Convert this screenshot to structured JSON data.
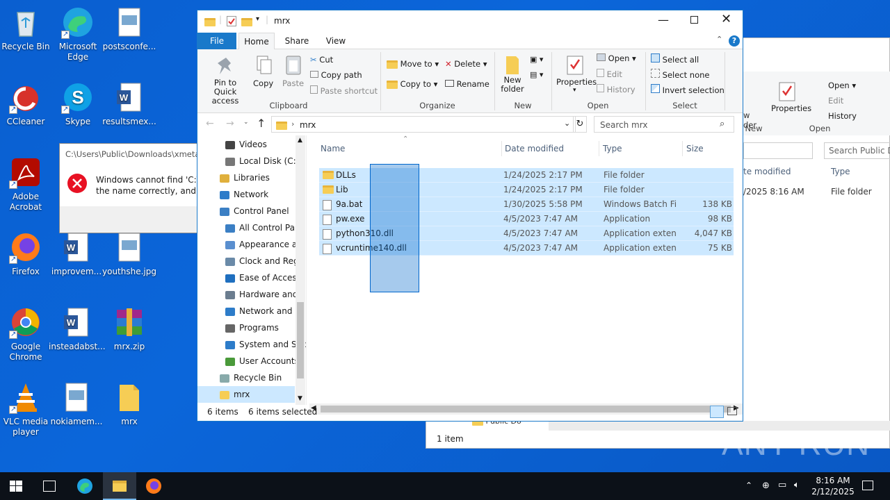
{
  "desktop": {
    "icons": [
      {
        "label": "Recycle Bin",
        "icon": "recycle-bin-icon"
      },
      {
        "label": "Microsoft Edge",
        "icon": "edge-icon"
      },
      {
        "label": "postsconfe...",
        "icon": "image-file-icon"
      },
      {
        "label": "CCleaner",
        "icon": "ccleaner-icon"
      },
      {
        "label": "Skype",
        "icon": "skype-icon"
      },
      {
        "label": "resultsmex...",
        "icon": "word-doc-icon"
      },
      {
        "label": "Adobe Acrobat",
        "icon": "acrobat-icon"
      },
      {
        "label": "c...",
        "icon": "file-icon"
      },
      {
        "label": "Firefox",
        "icon": "firefox-icon"
      },
      {
        "label": "improvem...",
        "icon": "word-doc-icon"
      },
      {
        "label": "youthshe.jpg",
        "icon": "image-file-icon"
      },
      {
        "label": "Google Chrome",
        "icon": "chrome-icon"
      },
      {
        "label": "insteadabst...",
        "icon": "word-doc-icon"
      },
      {
        "label": "mrx.zip",
        "icon": "winrar-icon"
      },
      {
        "label": "VLC media player",
        "icon": "vlc-icon"
      },
      {
        "label": "nokiamem...",
        "icon": "image-file-icon"
      },
      {
        "label": "mrx",
        "icon": "folder-icon"
      }
    ]
  },
  "error_dialog": {
    "path": "C:\\Users\\Public\\Downloads\\xmetav",
    "message_line1": "Windows cannot find 'C:\\Us",
    "message_line2": "the name correctly, and the"
  },
  "bg_explorer": {
    "ribbon": {
      "open": "Open",
      "edit": "Edit",
      "history": "History",
      "properties": "Properties",
      "open_group": "Open",
      "new_group": "New",
      "new_folder_partial": "w\nder"
    },
    "search_placeholder": "Search Public Do",
    "col_date": "te modified",
    "col_type": "Type",
    "row_date": "/2025 8:16 AM",
    "row_type": "File folder",
    "nav_partial": "Public Do",
    "status": "1 item"
  },
  "explorer": {
    "title": "mrx",
    "tabs": [
      "File",
      "Home",
      "Share",
      "View"
    ],
    "ribbon": {
      "pin": "Pin to Quick access",
      "copy": "Copy",
      "paste": "Paste",
      "cut": "Cut",
      "copy_path": "Copy path",
      "paste_shortcut": "Paste shortcut",
      "clipboard": "Clipboard",
      "move_to": "Move to",
      "copy_to": "Copy to",
      "delete": "Delete",
      "rename": "Rename",
      "organize": "Organize",
      "new_folder_1": "New",
      "new_folder_2": "folder",
      "new_group": "New",
      "properties": "Properties",
      "open": "Open",
      "edit": "Edit",
      "history": "History",
      "open_group": "Open",
      "select_all": "Select all",
      "select_none": "Select none",
      "invert_selection": "Invert selection",
      "select_group": "Select"
    },
    "address": {
      "path": "mrx",
      "search_placeholder": "Search mrx"
    },
    "nav": [
      {
        "label": "Videos",
        "icon": "videos-icon",
        "indent": 1
      },
      {
        "label": "Local Disk (C:)",
        "icon": "disk-icon",
        "indent": 1
      },
      {
        "label": "Libraries",
        "icon": "libraries-icon",
        "indent": 0
      },
      {
        "label": "Network",
        "icon": "network-icon",
        "indent": 0
      },
      {
        "label": "Control Panel",
        "icon": "control-panel-icon",
        "indent": 0
      },
      {
        "label": "All Control Par",
        "icon": "control-panel-icon",
        "indent": 1
      },
      {
        "label": "Appearance an",
        "icon": "appearance-icon",
        "indent": 1
      },
      {
        "label": "Clock and Regi",
        "icon": "clock-icon",
        "indent": 1
      },
      {
        "label": "Ease of Access",
        "icon": "ease-access-icon",
        "indent": 1
      },
      {
        "label": "Hardware and",
        "icon": "hardware-icon",
        "indent": 1
      },
      {
        "label": "Network and Ir",
        "icon": "network-icon",
        "indent": 1
      },
      {
        "label": "Programs",
        "icon": "programs-icon",
        "indent": 1
      },
      {
        "label": "System and Sec",
        "icon": "system-icon",
        "indent": 1
      },
      {
        "label": "User Accounts",
        "icon": "user-accounts-icon",
        "indent": 1
      },
      {
        "label": "Recycle Bin",
        "icon": "recycle-bin-icon",
        "indent": 0
      },
      {
        "label": "mrx",
        "icon": "folder-icon",
        "indent": 0
      }
    ],
    "columns": [
      "Name",
      "Date modified",
      "Type",
      "Size"
    ],
    "files": [
      {
        "name": "DLLs",
        "date": "1/24/2025 2:17 PM",
        "type": "File folder",
        "size": "",
        "icon": "folder-icon"
      },
      {
        "name": "Lib",
        "date": "1/24/2025 2:17 PM",
        "type": "File folder",
        "size": "",
        "icon": "folder-icon"
      },
      {
        "name": "9a.bat",
        "date": "1/30/2025 5:58 PM",
        "type": "Windows Batch File",
        "size": "138 KB",
        "icon": "batch-file-icon"
      },
      {
        "name": "pw.exe",
        "date": "4/5/2023 7:47 AM",
        "type": "Application",
        "size": "98 KB",
        "icon": "exe-icon"
      },
      {
        "name": "python310.dll",
        "date": "4/5/2023 7:47 AM",
        "type": "Application exten...",
        "size": "4,047 KB",
        "icon": "dll-icon"
      },
      {
        "name": "vcruntime140.dll",
        "date": "4/5/2023 7:47 AM",
        "type": "Application exten...",
        "size": "75 KB",
        "icon": "dll-icon"
      }
    ],
    "status": {
      "count": "6 items",
      "selected": "6 items selected"
    }
  },
  "taskbar": {
    "time": "8:16 AM",
    "date": "2/12/2025"
  },
  "watermark": "ANY RUN"
}
